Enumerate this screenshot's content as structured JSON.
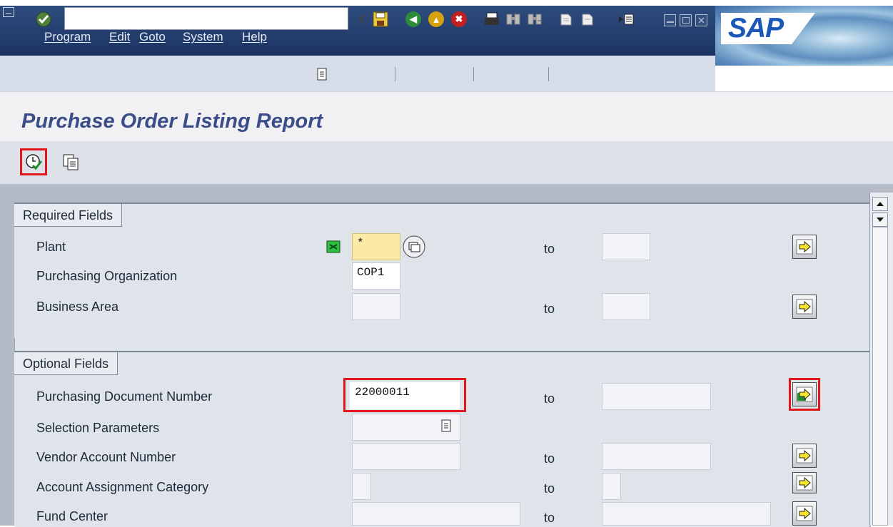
{
  "menu": {
    "items": [
      "Program",
      "Edit",
      "Goto",
      "System",
      "Help"
    ]
  },
  "logo": {
    "text": "SAP"
  },
  "page": {
    "title": "Purchase Order Listing Report"
  },
  "required": {
    "title": "Required Fields",
    "rows": [
      {
        "label": "Plant",
        "value": "*",
        "to": "to"
      },
      {
        "label": "Purchasing Organization",
        "value": "COP1"
      },
      {
        "label": "Business Area",
        "value": "",
        "to": "to"
      }
    ]
  },
  "optional": {
    "title": "Optional Fields",
    "rows": [
      {
        "label": "Purchasing Document Number",
        "value": "22000011",
        "to": "to"
      },
      {
        "label": "Selection Parameters",
        "value": ""
      },
      {
        "label": "Vendor Account Number",
        "value": "",
        "to": "to"
      },
      {
        "label": "Account Assignment Category",
        "value": "",
        "to": "to"
      },
      {
        "label": "Fund Center",
        "value": "",
        "to": "to"
      }
    ]
  },
  "colors": {
    "menubar": "#1c3462",
    "title": "#3a4d88",
    "highlight": "#e2171b",
    "required_field": "#fbe9a6"
  },
  "icons": {
    "toolbar": [
      "enter-icon",
      "command-dropdown-icon",
      "back-arrow-icon",
      "save-icon",
      "back-icon",
      "exit-icon",
      "cancel-icon",
      "print-icon",
      "find-icon",
      "find-next-icon",
      "first-page-icon",
      "previous-page-icon",
      "create-session-icon"
    ],
    "application": [
      "execute-icon",
      "get-variant-icon"
    ]
  }
}
